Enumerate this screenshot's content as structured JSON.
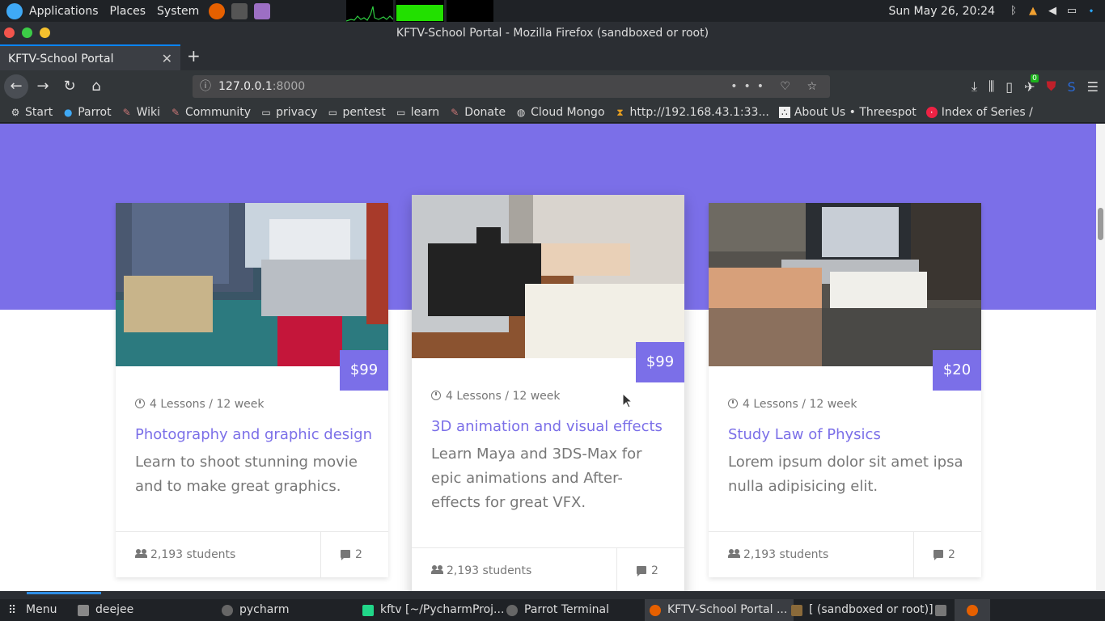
{
  "desktop": {
    "menus": [
      "Applications",
      "Places",
      "System"
    ],
    "clock": "Sun May 26, 20:24"
  },
  "browser": {
    "window_title": "KFTV-School Portal - Mozilla Firefox (sandboxed or root)",
    "tab_title": "KFTV-School Portal",
    "url_host": "127.0.0.1",
    "url_port": ":8000",
    "bookmarks": [
      "Start",
      "Parrot",
      "Wiki",
      "Community",
      "privacy",
      "pentest",
      "learn",
      "Donate",
      "Cloud Mongo",
      "http://192.168.43.1:33...",
      "About Us • Threespot",
      "Index of Series /"
    ],
    "extension_badge": "0"
  },
  "colors": {
    "accent": "#7b6fe8"
  },
  "courses": [
    {
      "price": "$99",
      "meta": "4 Lessons / 12 week",
      "title": "Photography and graphic design",
      "description": "Learn to shoot stunning movie and to make great graphics.",
      "students": "2,193 students",
      "comments": "2"
    },
    {
      "price": "$99",
      "meta": "4 Lessons / 12 week",
      "title": "3D animation and visual effects",
      "description": "Learn Maya and 3DS-Max for epic animations and After-effects for great VFX.",
      "students": "2,193 students",
      "comments": "2"
    },
    {
      "price": "$20",
      "meta": "4 Lessons / 12 week",
      "title": "Study Law of Physics",
      "description": "Lorem ipsum dolor sit amet ipsa nulla adipisicing elit.",
      "students": "2,193 students",
      "comments": "2"
    }
  ],
  "taskbar": {
    "menu_label": "Menu",
    "items": [
      "deejee",
      "pycharm",
      "kftv [~/PycharmProj...",
      "Parrot Terminal",
      "KFTV-School Portal ...",
      "[ (sandboxed or root)]"
    ]
  }
}
